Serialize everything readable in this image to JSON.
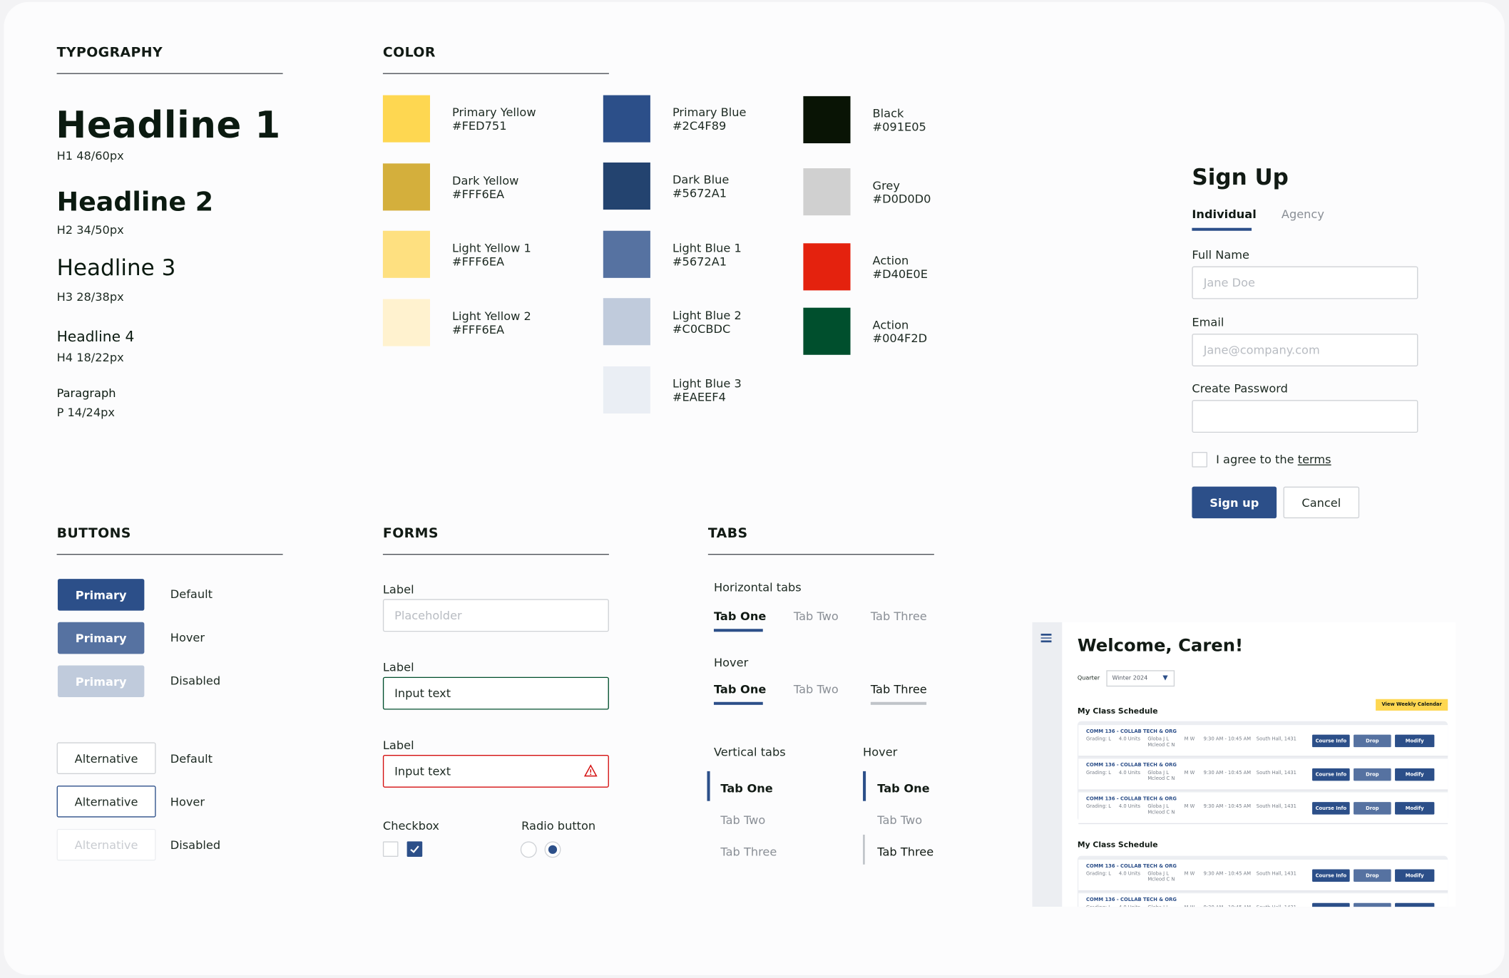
{
  "typography": {
    "title": "TYPOGRAPHY",
    "h1": "Headline 1",
    "h1_spec": "H1 48/60px",
    "h2": "Headline 2",
    "h2_spec": "H2 34/50px",
    "h3": "Headline 3",
    "h3_spec": "H3 28/38px",
    "h4": "Headline 4",
    "h4_spec": "H4 18/22px",
    "p": "Paragraph",
    "p_spec": "P 14/24px"
  },
  "color": {
    "title": "COLOR",
    "swatches": [
      {
        "name": "Primary Yellow",
        "hex": "#FED751",
        "swatch": "#FED751"
      },
      {
        "name": "Dark Yellow",
        "hex": "#FFF6EA",
        "swatch": "#D4AF3C"
      },
      {
        "name": "Light Yellow 1",
        "hex": "#FFF6EA",
        "swatch": "#FEE080"
      },
      {
        "name": "Light Yellow 2",
        "hex": "#FFF6EA",
        "swatch": "#FFF2CF"
      },
      {
        "name": "Primary Blue",
        "hex": "#2C4F89",
        "swatch": "#2C4F89"
      },
      {
        "name": "Dark Blue",
        "hex": "#5672A1",
        "swatch": "#23436F"
      },
      {
        "name": "Light Blue 1",
        "hex": "#5672A1",
        "swatch": "#5672A1"
      },
      {
        "name": "Light Blue 2",
        "hex": "#C0CBDC",
        "swatch": "#C0CBDC"
      },
      {
        "name": "Light Blue 3",
        "hex": "#EAEEF4",
        "swatch": "#EAEEF4"
      },
      {
        "name": "Black",
        "hex": "#091E05",
        "swatch": "#091405"
      },
      {
        "name": "Grey",
        "hex": "#D0D0D0",
        "swatch": "#D0D0D0"
      },
      {
        "name": "Action",
        "hex": "#D40E0E",
        "swatch": "#E4220E"
      },
      {
        "name": "Action",
        "hex": "#004F2D",
        "swatch": "#004F2D"
      }
    ]
  },
  "buttons": {
    "title": "BUTTONS",
    "primary": "Primary",
    "alternative": "Alternative",
    "default": "Default",
    "hover": "Hover",
    "disabled": "Disabled"
  },
  "forms": {
    "title": "FORMS",
    "label": "Label",
    "placeholder": "Placeholder",
    "input_text": "Input text",
    "checkbox": "Checkbox",
    "radio": "Radio button"
  },
  "tabs": {
    "title": "TABS",
    "horizontal": "Horizontal tabs",
    "hover": "Hover",
    "vertical": "Vertical tabs",
    "tab_one": "Tab One",
    "tab_two": "Tab Two",
    "tab_three": "Tab Three"
  },
  "signup": {
    "title": "Sign Up",
    "tab_individual": "Individual",
    "tab_agency": "Agency",
    "full_name_label": "Full Name",
    "full_name_placeholder": "Jane Doe",
    "email_label": "Email",
    "email_placeholder": "Jane@company.com",
    "password_label": "Create Password",
    "agree_text": "I agree to the ",
    "terms_link": "terms",
    "submit": "Sign up",
    "cancel": "Cancel"
  },
  "dashboard": {
    "welcome": "Welcome, Caren!",
    "quarter_label": "Quarter",
    "quarter_value": "Winter 2024",
    "calendar_button": "View Weekly Calendar",
    "schedule_title": "My Class Schedule",
    "course": {
      "name": "COMM 136 - COLLAB TECH & ORG",
      "grading": "Grading: L",
      "units": "4.0 Units",
      "instructor1": "Globa J L",
      "instructor2": "Mcleod C N",
      "days": "M W",
      "time": "9:30 AM - 10:45 AM",
      "location": "South Hall, 1431"
    },
    "btn_info": "Course Info",
    "btn_drop": "Drop",
    "btn_modify": "Modify"
  },
  "colors": {
    "primary": "#2C4F89",
    "hover": "#5672A1",
    "disabled": "#C0CBDC",
    "success": "#004F2D",
    "error": "#D40E0E",
    "yellow": "#FED751"
  }
}
